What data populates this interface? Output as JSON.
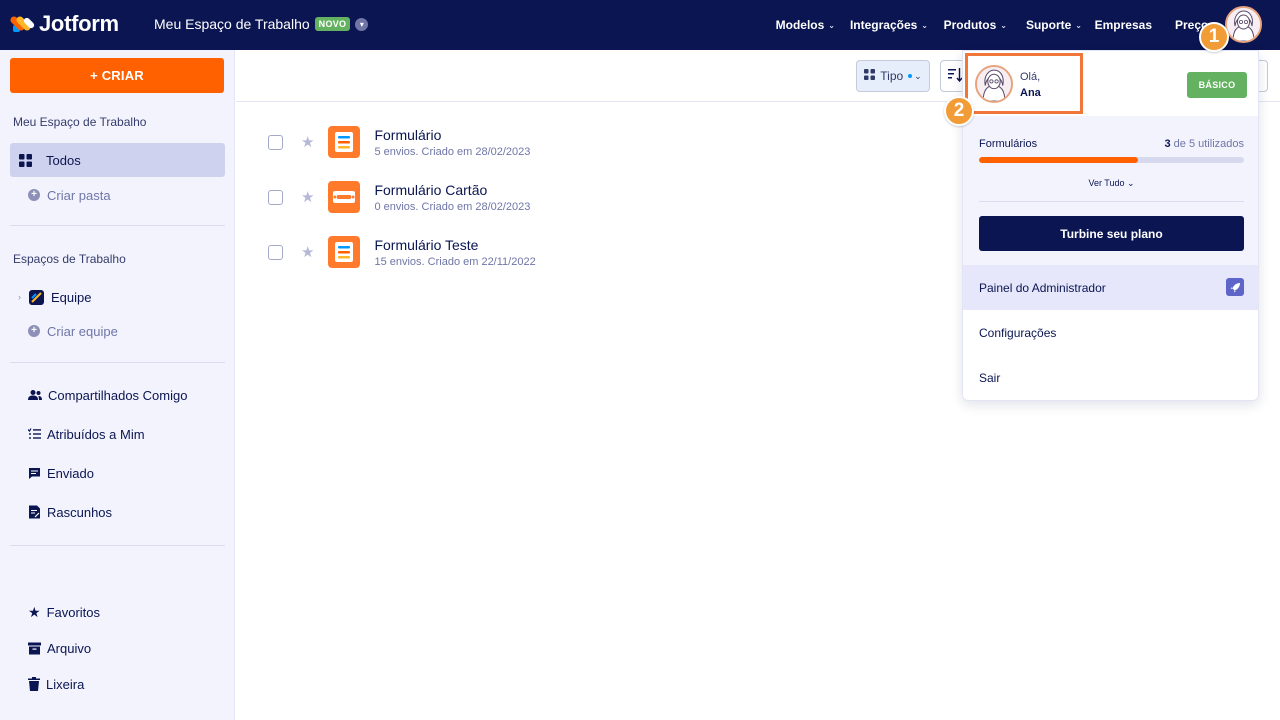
{
  "app": {
    "brand": "Jotform"
  },
  "header": {
    "workspace_title": "Meu Espaço de Trabalho",
    "new_badge": "NOVO",
    "nav": [
      "Modelos",
      "Integrações",
      "Produtos",
      "Suporte",
      "Empresas",
      "Preços"
    ]
  },
  "sidebar": {
    "create_label": "+ CRIAR",
    "my_workspace_heading": "Meu Espaço de Trabalho",
    "all_label": "Todos",
    "create_folder_label": "Criar pasta",
    "workspaces_heading": "Espaços de Trabalho",
    "team_label": "Equipe",
    "create_team_label": "Criar equipe",
    "items": [
      {
        "label": "Compartilhados Comigo",
        "icon": "users-icon"
      },
      {
        "label": "Atribuídos a Mim",
        "icon": "checklist-icon"
      },
      {
        "label": "Enviado",
        "icon": "message-icon"
      },
      {
        "label": "Rascunhos",
        "icon": "draft-icon"
      }
    ],
    "bottom_items": [
      {
        "label": "Favoritos",
        "icon": "star-icon"
      },
      {
        "label": "Arquivo",
        "icon": "archive-icon"
      },
      {
        "label": "Lixeira",
        "icon": "trash-icon"
      }
    ]
  },
  "toolbar": {
    "type_label": "Tipo"
  },
  "forms": [
    {
      "title": "Formulário",
      "meta": "5 envios. Criado em 28/02/2023",
      "icon": "form-icon"
    },
    {
      "title": "Formulário Cartão",
      "meta": "0 envios. Criado em 28/02/2023",
      "icon": "card-form-icon"
    },
    {
      "title": "Formulário Teste",
      "meta": "15 envios. Criado em 22/11/2022",
      "icon": "form-icon"
    }
  ],
  "dropdown": {
    "greeting": "Olá,",
    "name": "Ana",
    "plan": "BÁSICO",
    "usage_label": "Formulários",
    "usage_used": "3",
    "usage_rest": " de 5 utilizados",
    "usage_fraction": 0.6,
    "view_all": "Ver Tudo",
    "upgrade_label": "Turbine seu plano",
    "admin_label": "Painel do Administrador",
    "settings_label": "Configurações",
    "logout_label": "Sair"
  },
  "annotations": {
    "step1": "1",
    "step2": "2"
  },
  "colors": {
    "accent": "#ff6100",
    "navy": "#0a1551",
    "green": "#64b261",
    "annotation": "#f29c38"
  }
}
